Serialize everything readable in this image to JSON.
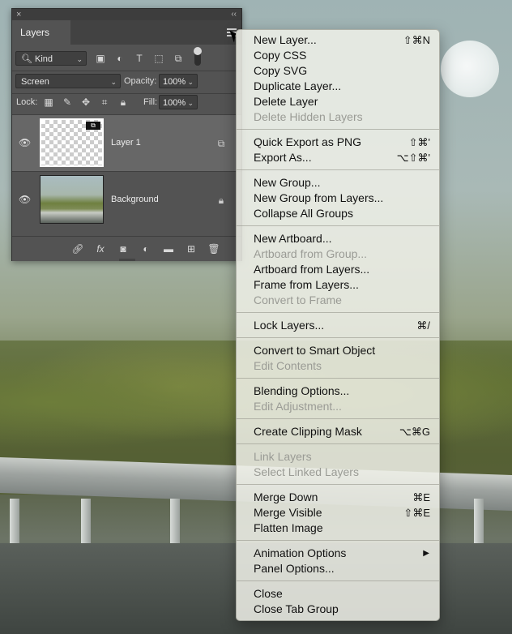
{
  "panel": {
    "close_label": "×",
    "collapse_label": "‹‹",
    "tab_label": "Layers",
    "filter_kind": "Kind",
    "blend_mode": "Screen",
    "opacity_label": "Opacity:",
    "opacity_value": "100%",
    "lock_label": "Lock:",
    "fill_label": "Fill:",
    "fill_value": "100%",
    "layers": [
      {
        "name": "Layer 1",
        "visible": true,
        "selected": true
      },
      {
        "name": "Background",
        "visible": true,
        "locked": true
      }
    ]
  },
  "menu": {
    "groups": [
      [
        {
          "label": "New Layer...",
          "shortcut": "⇧⌘N",
          "enabled": true
        },
        {
          "label": "Copy CSS",
          "shortcut": "",
          "enabled": true
        },
        {
          "label": "Copy SVG",
          "shortcut": "",
          "enabled": true
        },
        {
          "label": "Duplicate Layer...",
          "shortcut": "",
          "enabled": true
        },
        {
          "label": "Delete Layer",
          "shortcut": "",
          "enabled": true
        },
        {
          "label": "Delete Hidden Layers",
          "shortcut": "",
          "enabled": false
        }
      ],
      [
        {
          "label": "Quick Export as PNG",
          "shortcut": "⇧⌘'",
          "enabled": true
        },
        {
          "label": "Export As...",
          "shortcut": "⌥⇧⌘'",
          "enabled": true
        }
      ],
      [
        {
          "label": "New Group...",
          "shortcut": "",
          "enabled": true
        },
        {
          "label": "New Group from Layers...",
          "shortcut": "",
          "enabled": true
        },
        {
          "label": "Collapse All Groups",
          "shortcut": "",
          "enabled": true
        }
      ],
      [
        {
          "label": "New Artboard...",
          "shortcut": "",
          "enabled": true
        },
        {
          "label": "Artboard from Group...",
          "shortcut": "",
          "enabled": false
        },
        {
          "label": "Artboard from Layers...",
          "shortcut": "",
          "enabled": true
        },
        {
          "label": "Frame from Layers...",
          "shortcut": "",
          "enabled": true
        },
        {
          "label": "Convert to Frame",
          "shortcut": "",
          "enabled": false
        }
      ],
      [
        {
          "label": "Lock Layers...",
          "shortcut": "⌘/",
          "enabled": true
        }
      ],
      [
        {
          "label": "Convert to Smart Object",
          "shortcut": "",
          "enabled": true
        },
        {
          "label": "Edit Contents",
          "shortcut": "",
          "enabled": false
        }
      ],
      [
        {
          "label": "Blending Options...",
          "shortcut": "",
          "enabled": true
        },
        {
          "label": "Edit Adjustment...",
          "shortcut": "",
          "enabled": false
        }
      ],
      [
        {
          "label": "Create Clipping Mask",
          "shortcut": "⌥⌘G",
          "enabled": true
        }
      ],
      [
        {
          "label": "Link Layers",
          "shortcut": "",
          "enabled": false
        },
        {
          "label": "Select Linked Layers",
          "shortcut": "",
          "enabled": false
        }
      ],
      [
        {
          "label": "Merge Down",
          "shortcut": "⌘E",
          "enabled": true
        },
        {
          "label": "Merge Visible",
          "shortcut": "⇧⌘E",
          "enabled": true
        },
        {
          "label": "Flatten Image",
          "shortcut": "",
          "enabled": true
        }
      ],
      [
        {
          "label": "Animation Options",
          "shortcut": "",
          "enabled": true,
          "submenu": true
        },
        {
          "label": "Panel Options...",
          "shortcut": "",
          "enabled": true
        }
      ],
      [
        {
          "label": "Close",
          "shortcut": "",
          "enabled": true
        },
        {
          "label": "Close Tab Group",
          "shortcut": "",
          "enabled": true
        }
      ]
    ]
  }
}
